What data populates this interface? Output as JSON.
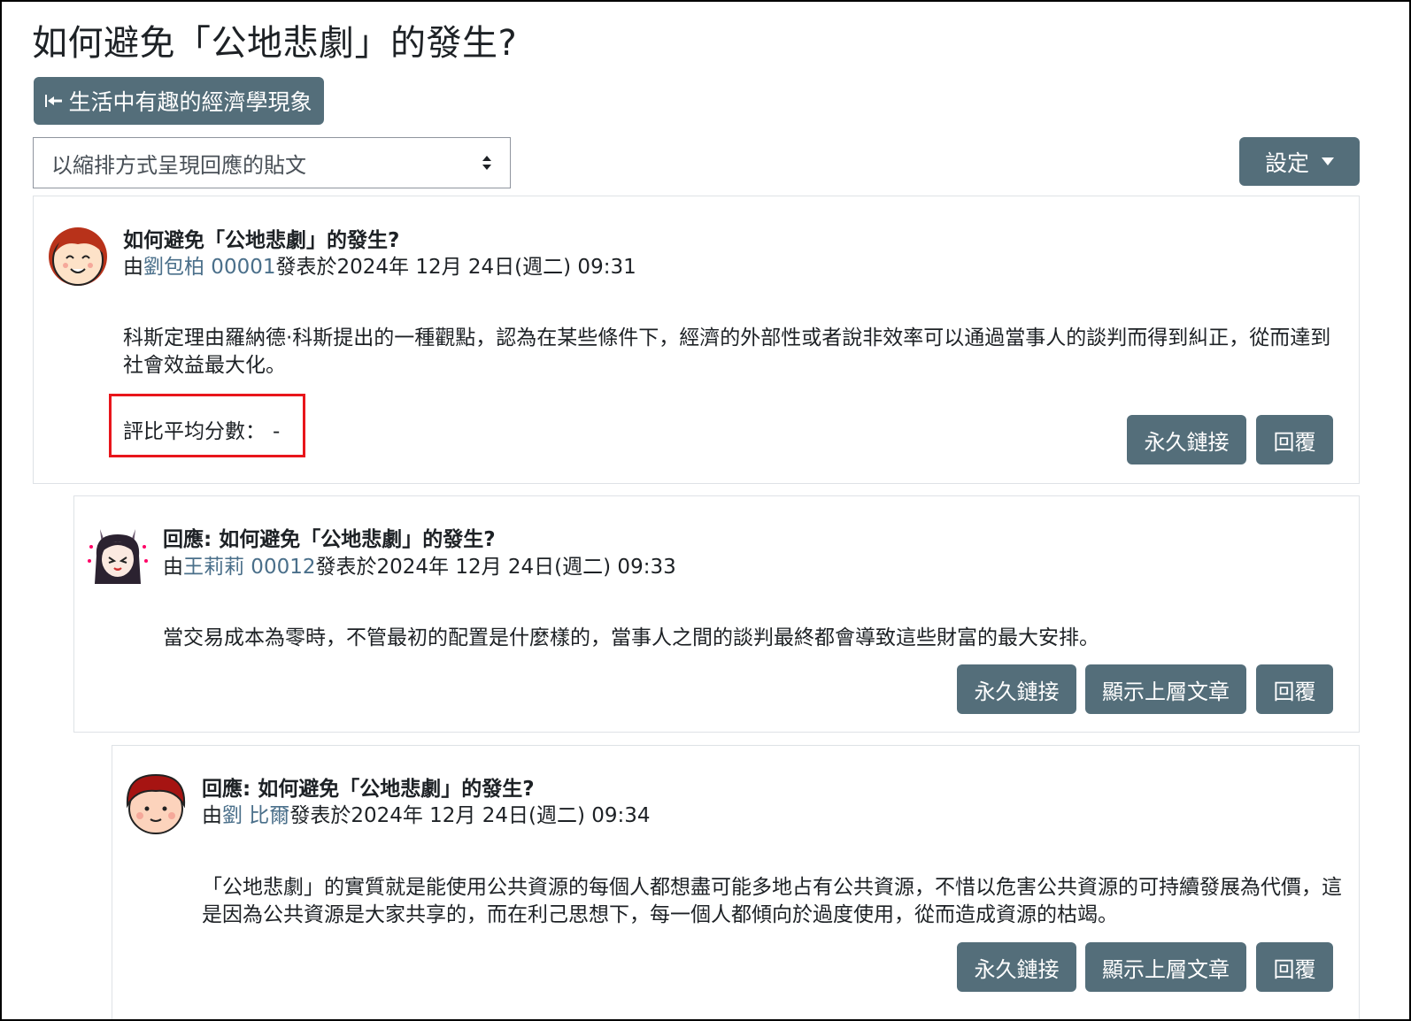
{
  "page": {
    "title": "如何避免「公地悲劇」的發生?",
    "back_button": "生活中有趣的經濟學現象",
    "display_mode": "以縮排方式呈現回應的貼文",
    "settings_button": "設定"
  },
  "posts": [
    {
      "subject": "如何避免「公地悲劇」的發生?",
      "meta_prefix": "由",
      "author": "劉包柏 00001",
      "meta_suffix": "發表於2024年 12月 24日(週二) 09:31",
      "body": "科斯定理由羅納德·科斯提出的一種觀點，認為在某些條件下，經濟的外部性或者說非效率可以通過當事人的談判而得到糾正，從而達到社會效益最大化。",
      "rating_label": "評比平均分數：",
      "rating_value": "-",
      "buttons": {
        "permalink": "永久鏈接",
        "reply": "回覆"
      }
    },
    {
      "subject": "回應: 如何避免「公地悲劇」的發生?",
      "meta_prefix": "由",
      "author": "王莉莉 00012",
      "meta_suffix": "發表於2024年 12月 24日(週二) 09:33",
      "body": "當交易成本為零時，不管最初的配置是什麼樣的，當事人之間的談判最終都會導致這些財富的最大安排。",
      "buttons": {
        "permalink": "永久鏈接",
        "show_parent": "顯示上層文章",
        "reply": "回覆"
      }
    },
    {
      "subject": "回應: 如何避免「公地悲劇」的發生?",
      "meta_prefix": "由",
      "author": "劉 比爾",
      "meta_suffix": "發表於2024年 12月 24日(週二) 09:34",
      "body": "「公地悲劇」的實質就是能使用公共資源的每個人都想盡可能多地占有公共資源，不惜以危害公共資源的可持續發展為代價，這是因為公共資源是大家共享的，而在利己思想下，每一個人都傾向於過度使用，從而造成資源的枯竭。",
      "buttons": {
        "permalink": "永久鏈接",
        "show_parent": "顯示上層文章",
        "reply": "回覆"
      }
    }
  ],
  "colors": {
    "button_bg": "#546e7a",
    "author_link": "#4a6f8a",
    "highlight_border": "#e8151b"
  }
}
